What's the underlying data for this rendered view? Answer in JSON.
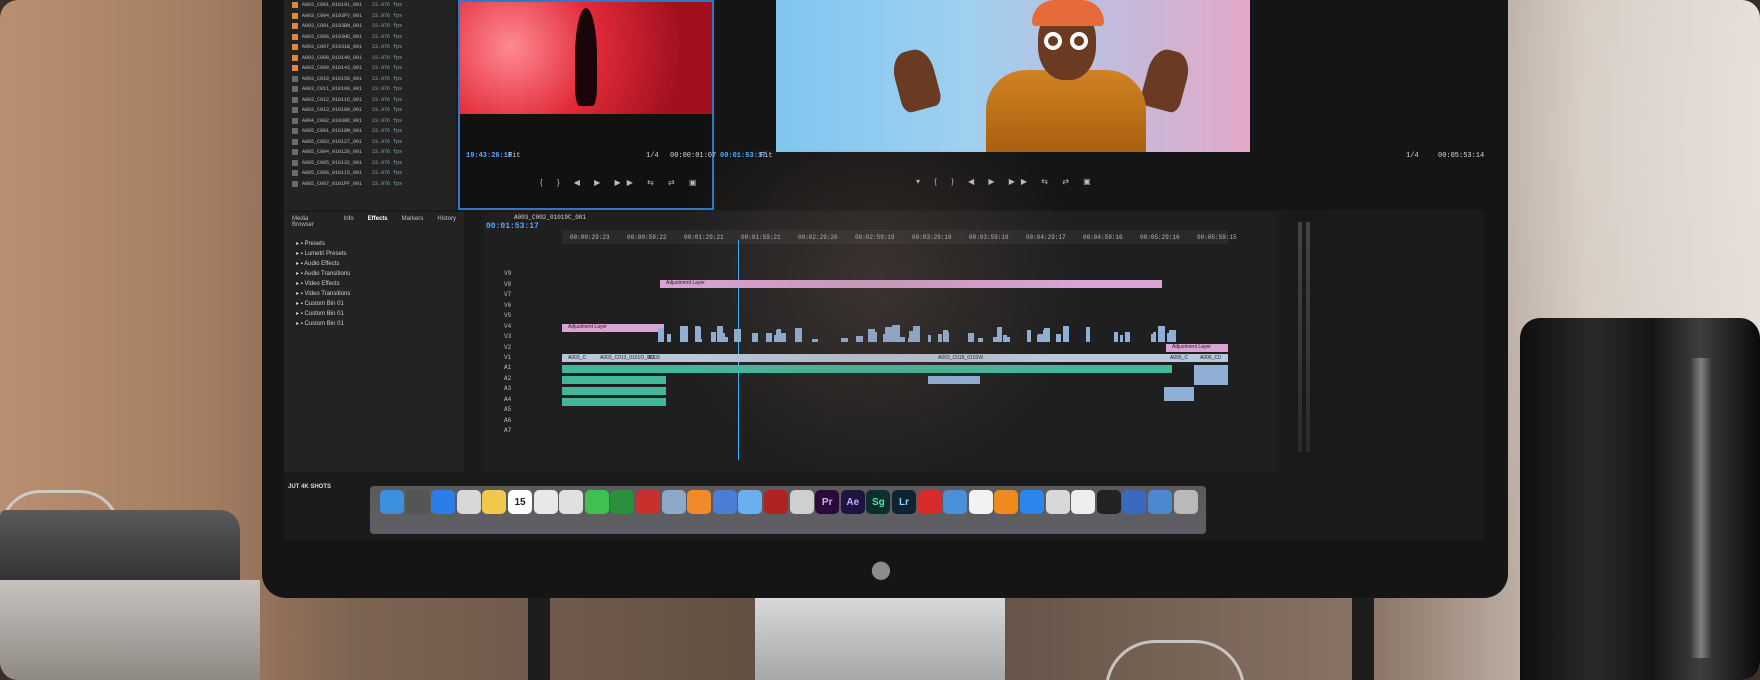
{
  "project_panel": {
    "items": [
      {
        "name": "A003_C001_010191_001",
        "fps": "23.976 fps",
        "color": "#e0873a"
      },
      {
        "name": "A003_C004_0103PV_001",
        "fps": "23.976 fps",
        "color": "#e0873a"
      },
      {
        "name": "A003_C001_0103BN_001",
        "fps": "23.976 fps",
        "color": "#e0873a"
      },
      {
        "name": "A003_C006_0103HD_001",
        "fps": "23.976 fps",
        "color": "#e0873a"
      },
      {
        "name": "A003_C007_01031B_001",
        "fps": "23.976 fps",
        "color": "#e0873a"
      },
      {
        "name": "A003_C008_010149_001",
        "fps": "23.976 fps",
        "color": "#e0873a"
      },
      {
        "name": "A003_C009_010143_001",
        "fps": "23.976 fps",
        "color": "#e0873a"
      },
      {
        "name": "A003_C010_010158_001",
        "fps": "23.976 fps",
        "color": "#6b6b6b"
      },
      {
        "name": "A003_C011_010108_001",
        "fps": "23.976 fps",
        "color": "#6b6b6b"
      },
      {
        "name": "A003_C012_010116_001",
        "fps": "23.976 fps",
        "color": "#6b6b6b"
      },
      {
        "name": "A003_C013_010109_001",
        "fps": "23.976 fps",
        "color": "#6b6b6b"
      },
      {
        "name": "A004_C002_01038D_001",
        "fps": "23.976 fps",
        "color": "#6b6b6b"
      },
      {
        "name": "A005_C001_01018M_001",
        "fps": "23.976 fps",
        "color": "#6b6b6b"
      },
      {
        "name": "A005_C003_010127_001",
        "fps": "23.976 fps",
        "color": "#6b6b6b"
      },
      {
        "name": "A005_C004_010128_001",
        "fps": "23.976 fps",
        "color": "#6b6b6b"
      },
      {
        "name": "A005_C005_010132_001",
        "fps": "23.976 fps",
        "color": "#6b6b6b"
      },
      {
        "name": "A005_C006_010115_001",
        "fps": "23.976 fps",
        "color": "#6b6b6b"
      },
      {
        "name": "A005_C007_0101PF_001",
        "fps": "23.976 fps",
        "color": "#6b6b6b"
      }
    ]
  },
  "source_monitor": {
    "timecode_in": "19:43:26:18",
    "fit": "Fit",
    "zoom": "1/4",
    "timecode_out": "00:00:01:07"
  },
  "program_monitor": {
    "timecode_in": "00:01:53:17",
    "fit": "Fit",
    "zoom": "1/4",
    "timecode_out": "00:05:53:14"
  },
  "effects_panel": {
    "tabs": [
      "Media Browser",
      "Info",
      "Effects",
      "Markers",
      "History"
    ],
    "active_tab": "Effects",
    "items": [
      "Presets",
      "Lumetri Presets",
      "Audio Effects",
      "Audio Transitions",
      "Video Effects",
      "Video Transitions",
      "Custom Bin 01",
      "Custom Bin 01",
      "Custom Bin 01"
    ]
  },
  "timeline": {
    "sequence_name": "A003_C002_01019C_001",
    "timecode": "00:01:53:17",
    "ruler": [
      "00:00:29:23",
      "00:00:59:22",
      "00:01:29:21",
      "00:01:59:21",
      "00:02:29:20",
      "00:02:59:19",
      "00:03:29:18",
      "00:03:59:18",
      "00:04:29:17",
      "00:04:59:16",
      "00:05:29:16",
      "00:05:59:15"
    ],
    "video_tracks": [
      "V9",
      "V8",
      "V7",
      "V6",
      "V5",
      "V4",
      "V3",
      "V2",
      "V1"
    ],
    "audio_tracks": [
      "A1",
      "A2",
      "A3",
      "A4",
      "A5",
      "A6",
      "A7"
    ],
    "clip_labels": {
      "adjustment_top": "Adjustment Layer",
      "adjustment_mid": "Adjustment Layer",
      "adjustment_right": "Adjustment Layer",
      "v1_a": "A003_C",
      "v1_b": "A003_C013_0101D_001",
      "v1_c": "A003",
      "v1_d": "A003_C018_0103W",
      "v1_e": "A005_C",
      "v1_f": "A006_C0"
    }
  },
  "dock": {
    "label": "JUT 4K SHOTS",
    "calendar_day": "15",
    "adobe_apps": [
      "Pr",
      "Ae",
      "Sg",
      "Lr"
    ]
  },
  "colors": {
    "accent_blue": "#2e79c7",
    "adjustment_pink": "#d9a4d4",
    "video_clip_blue": "#8fb0d6",
    "audio_clip_green": "#42b89a"
  }
}
